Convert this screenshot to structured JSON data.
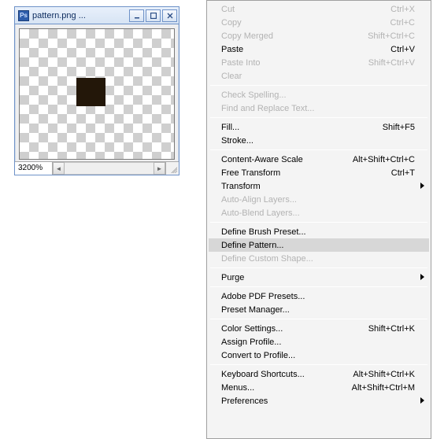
{
  "window": {
    "title": "pattern.png ...",
    "ps_label": "Ps",
    "zoom": "3200%",
    "swatch_color": "#231709"
  },
  "menu": {
    "groups": [
      [
        {
          "label": "Cut",
          "accel": "Ctrl+X",
          "disabled": true
        },
        {
          "label": "Copy",
          "accel": "Ctrl+C",
          "disabled": true
        },
        {
          "label": "Copy Merged",
          "accel": "Shift+Ctrl+C",
          "disabled": true
        },
        {
          "label": "Paste",
          "accel": "Ctrl+V"
        },
        {
          "label": "Paste Into",
          "accel": "Shift+Ctrl+V",
          "disabled": true
        },
        {
          "label": "Clear",
          "disabled": true
        }
      ],
      [
        {
          "label": "Check Spelling...",
          "disabled": true
        },
        {
          "label": "Find and Replace Text...",
          "disabled": true
        }
      ],
      [
        {
          "label": "Fill...",
          "accel": "Shift+F5"
        },
        {
          "label": "Stroke..."
        }
      ],
      [
        {
          "label": "Content-Aware Scale",
          "accel": "Alt+Shift+Ctrl+C"
        },
        {
          "label": "Free Transform",
          "accel": "Ctrl+T"
        },
        {
          "label": "Transform",
          "submenu": true
        },
        {
          "label": "Auto-Align Layers...",
          "disabled": true
        },
        {
          "label": "Auto-Blend Layers...",
          "disabled": true
        }
      ],
      [
        {
          "label": "Define Brush Preset..."
        },
        {
          "label": "Define Pattern...",
          "highlight": true
        },
        {
          "label": "Define Custom Shape...",
          "disabled": true
        }
      ],
      [
        {
          "label": "Purge",
          "submenu": true
        }
      ],
      [
        {
          "label": "Adobe PDF Presets..."
        },
        {
          "label": "Preset Manager..."
        }
      ],
      [
        {
          "label": "Color Settings...",
          "accel": "Shift+Ctrl+K"
        },
        {
          "label": "Assign Profile..."
        },
        {
          "label": "Convert to Profile..."
        }
      ],
      [
        {
          "label": "Keyboard Shortcuts...",
          "accel": "Alt+Shift+Ctrl+K"
        },
        {
          "label": "Menus...",
          "accel": "Alt+Shift+Ctrl+M"
        },
        {
          "label": "Preferences",
          "submenu": true
        }
      ]
    ]
  }
}
